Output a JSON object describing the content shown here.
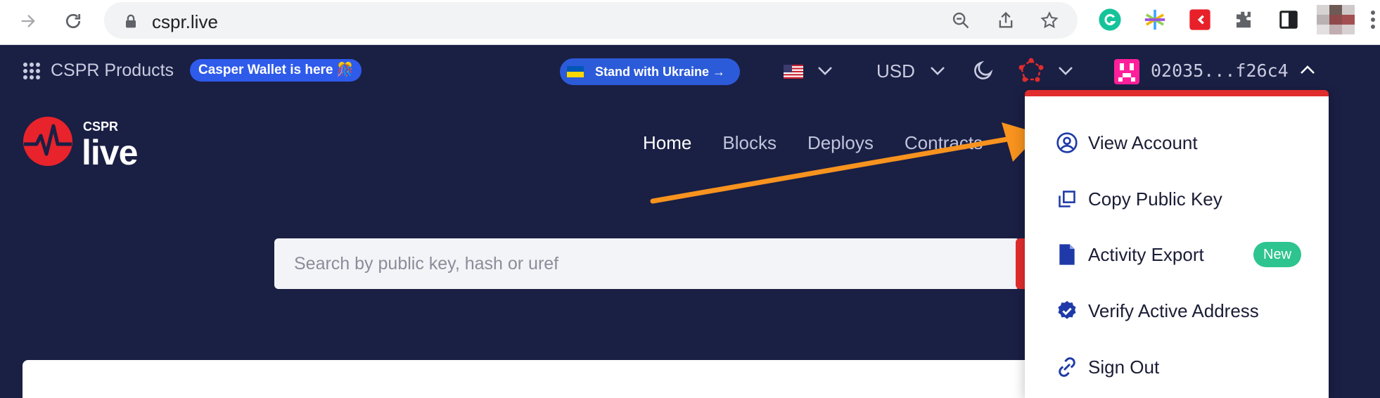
{
  "browser": {
    "url": "cspr.live"
  },
  "topbar": {
    "products_label": "CSPR Products",
    "wallet_badge": "Casper Wallet is here 🎊",
    "ukraine_label": "Stand with Ukraine →",
    "currency": "USD",
    "account_key": "02035...f26c4"
  },
  "header": {
    "logo_small": "CSPR",
    "logo_big": "live",
    "nav": [
      "Home",
      "Blocks",
      "Deploys",
      "Contracts"
    ]
  },
  "search": {
    "placeholder": "Search by public key, hash or uref"
  },
  "dropdown": {
    "items": [
      {
        "label": "View Account",
        "icon": "user-circle-icon"
      },
      {
        "label": "Copy Public Key",
        "icon": "copy-icon"
      },
      {
        "label": "Activity Export",
        "icon": "document-icon",
        "badge": "New"
      },
      {
        "label": "Verify Active Address",
        "icon": "verified-badge-icon"
      },
      {
        "label": "Sign Out",
        "icon": "unlink-icon"
      }
    ]
  },
  "colors": {
    "background": "#1a1f44",
    "accent_red": "#e02d2d",
    "badge_green": "#2ec48f",
    "arrow_orange": "#f7931e"
  }
}
